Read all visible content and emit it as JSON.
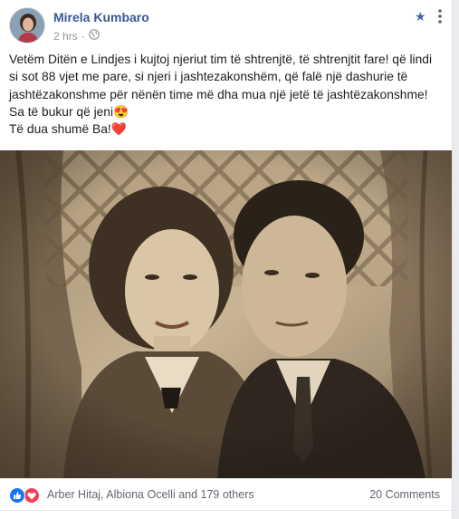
{
  "post": {
    "author": "Mirela Kumbaro",
    "time": "2 hrs",
    "separator": "·",
    "text_lines": [
      "Vetëm Ditën e Lindjes i kujtoj njeriut tim të shtrenjtë, të shtrenjtit fare! që lindi",
      "si sot 88 vjet me pare, si njeri i jashtezakonshëm, që falë një dashurie të",
      "jashtëzakonshme për nënën time më dha mua një jetë të jashtëzakonshme!",
      "Sa të bukur që jeni😍",
      "Të dua shumë Ba!❤️"
    ]
  },
  "footer": {
    "likers": "Arber Hitaj, Albiona Ocelli and 179 others",
    "comments": "20 Comments"
  },
  "icons": {
    "privacy": "globe-icon",
    "star": "star-icon",
    "more": "more-icon",
    "like": "like-icon",
    "love": "love-icon"
  },
  "colors": {
    "link": "#385898",
    "like": "#1877f2",
    "love": "#f33e58",
    "meta": "#90949c"
  }
}
